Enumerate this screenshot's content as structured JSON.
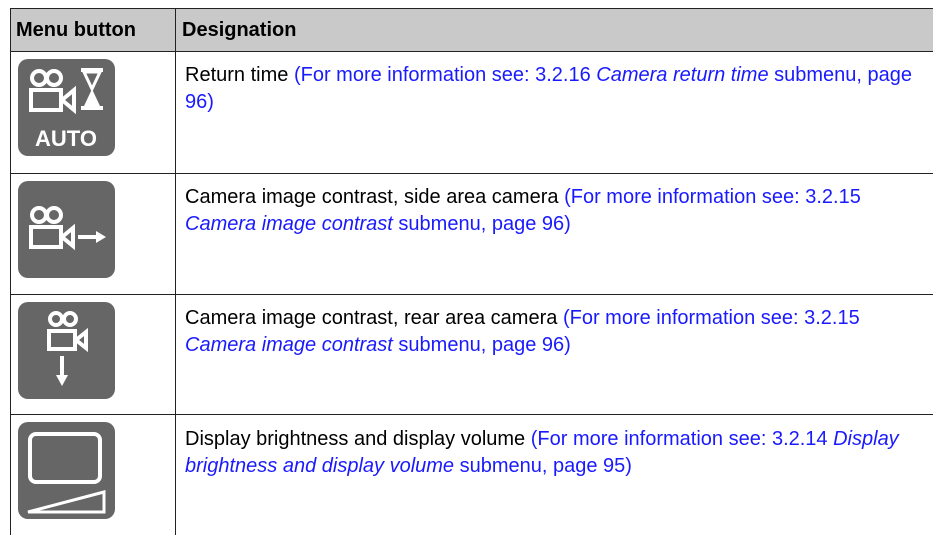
{
  "header": {
    "col1": "Menu button",
    "col2": "Designation"
  },
  "rows": [
    {
      "icon": "camera-return-time-auto-icon",
      "text": "Return time",
      "link_pre": "(For more information see: 3.2.16 ",
      "link_italic": "Camera return time",
      "link_post": " submenu, page 96)"
    },
    {
      "icon": "camera-side-contrast-icon",
      "text": "Camera image contrast, side area camera",
      "link_pre": "(For more information see: 3.2.15 ",
      "link_italic": "Camera image contrast",
      "link_post": " submenu, page 96)"
    },
    {
      "icon": "camera-rear-contrast-icon",
      "text": "Camera image contrast, rear area camera",
      "link_pre": "(For more information see: 3.2.15 ",
      "link_italic": "Camera image contrast",
      "link_post": " submenu, page 96)"
    },
    {
      "icon": "display-brightness-volume-icon",
      "text": "Display brightness and display volume",
      "link_pre": "(For more information see: 3.2.14 ",
      "link_italic": "Display brightness and display volume",
      "link_post": " submenu, page 95)"
    }
  ],
  "icon_labels": {
    "auto": "AUTO"
  },
  "colors": {
    "header_bg": "#c9c9c9",
    "icon_bg": "#666666",
    "link": "#1a1aff"
  }
}
